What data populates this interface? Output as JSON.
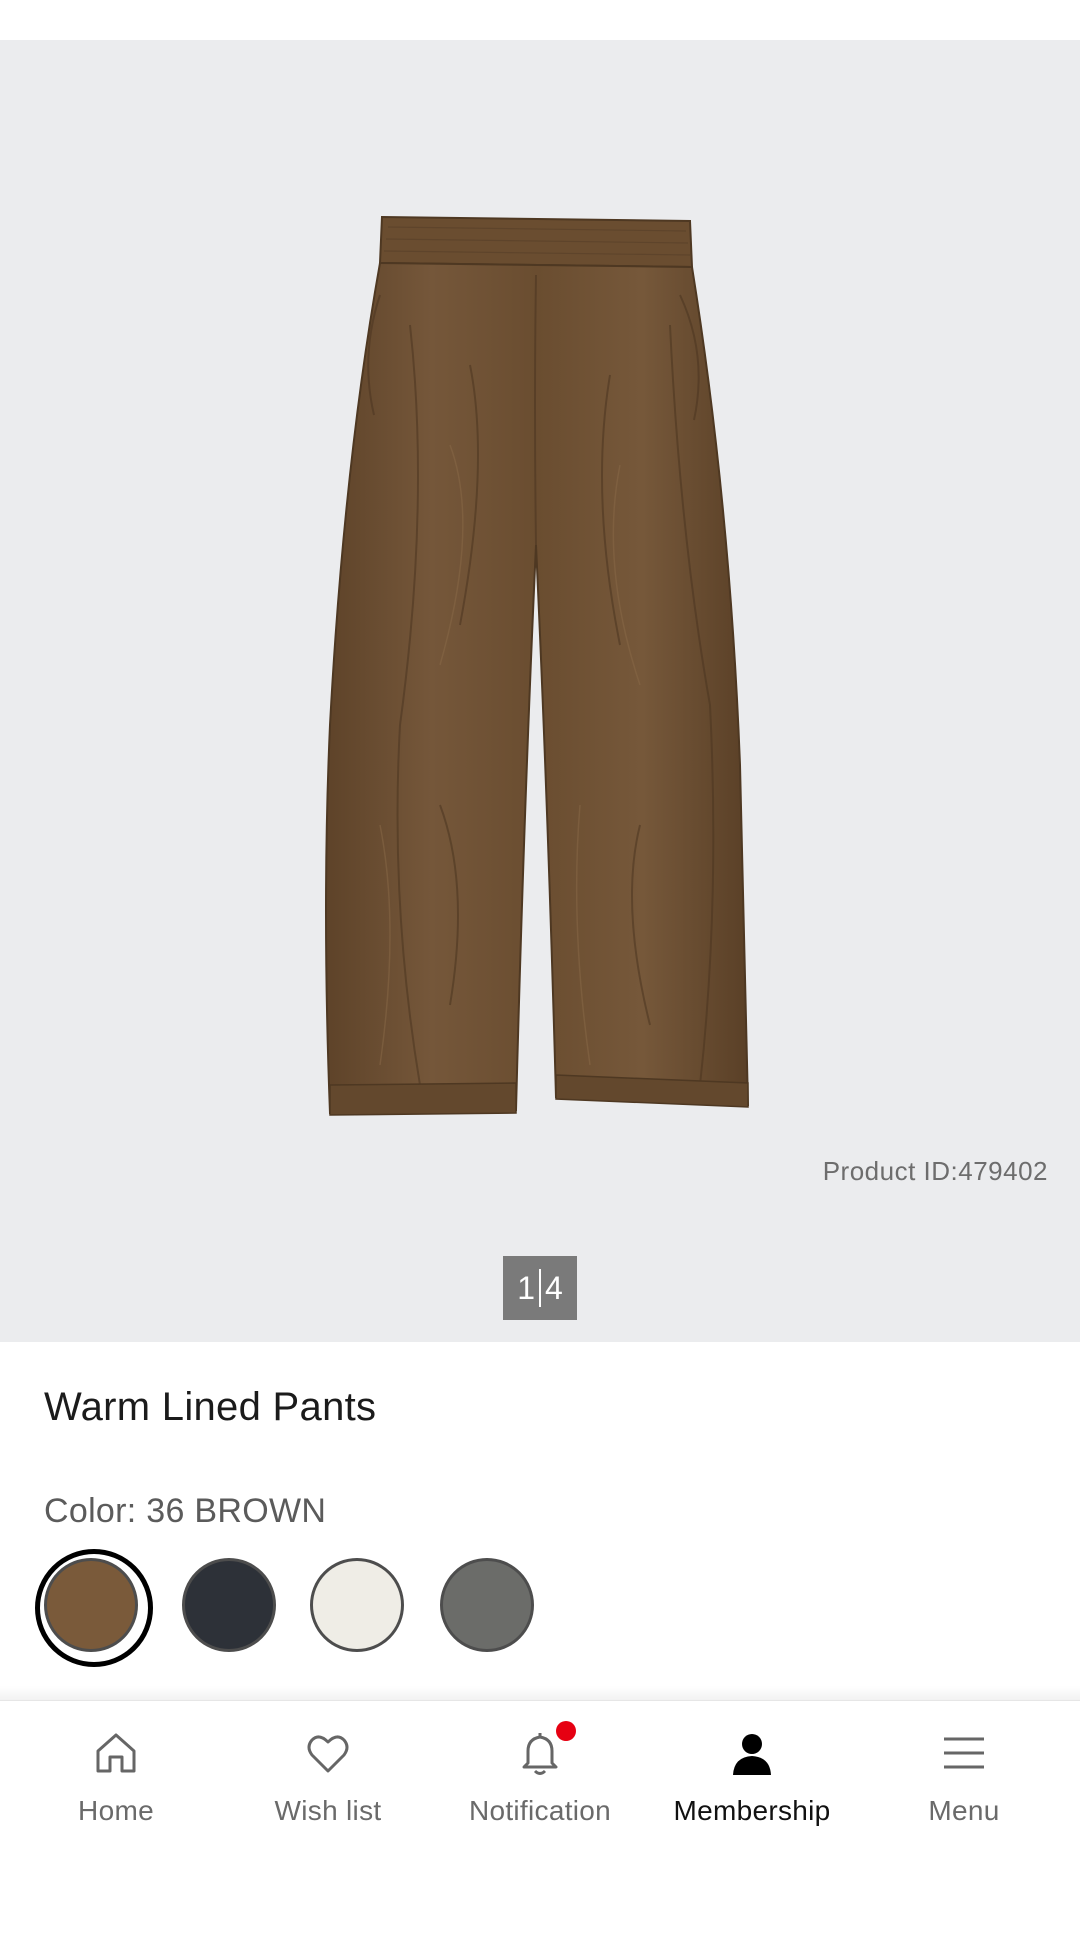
{
  "product": {
    "id_text": "Product ID:479402",
    "title": "Warm Lined Pants",
    "color_label": "Color: 36 BROWN",
    "image_pager": {
      "current": "1",
      "total": "4"
    },
    "swatches": [
      {
        "name": "brown",
        "color": "#7a5a3a",
        "selected": true
      },
      {
        "name": "navy",
        "color": "#2d3138",
        "selected": false
      },
      {
        "name": "off-white",
        "color": "#efede6",
        "selected": false
      },
      {
        "name": "gray",
        "color": "#6b6c69",
        "selected": false
      }
    ]
  },
  "bottom_nav": {
    "items": [
      {
        "label": "Home",
        "icon": "home-icon"
      },
      {
        "label": "Wish list",
        "icon": "heart-icon"
      },
      {
        "label": "Notification",
        "icon": "bell-icon",
        "badge": true
      },
      {
        "label": "Membership",
        "icon": "person-icon",
        "active": true
      },
      {
        "label": "Menu",
        "icon": "hamburger-icon"
      }
    ]
  },
  "colors": {
    "hero_background": "#ebecee",
    "pants": "#6f5232",
    "badge": "#e60012",
    "pager_background": "#7a7a7a"
  }
}
